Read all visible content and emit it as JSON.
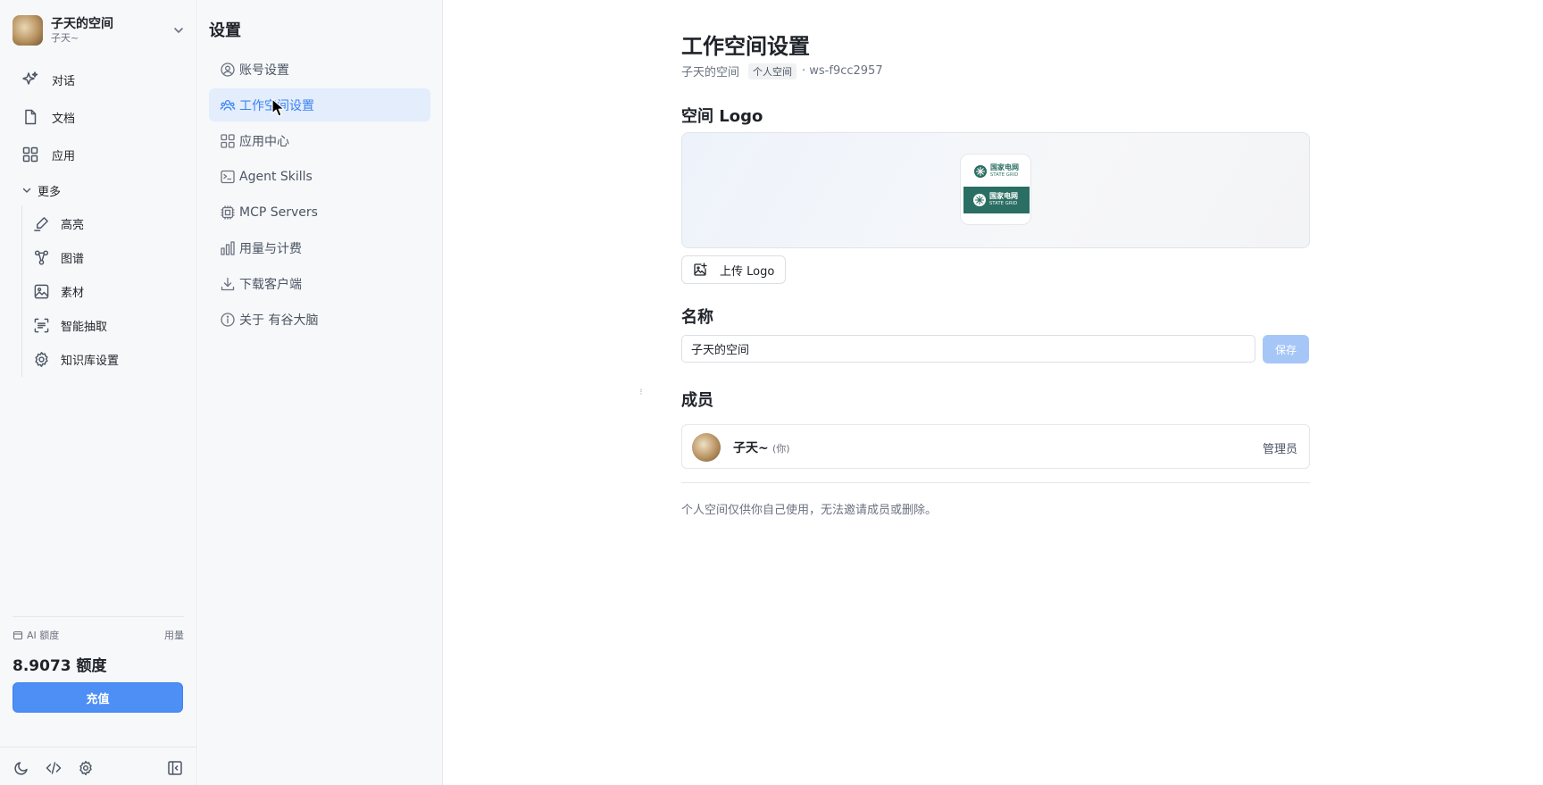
{
  "workspace": {
    "name": "子天的空间",
    "user": "子天~"
  },
  "nav": {
    "items": [
      {
        "label": "对话",
        "icon": "sparkle-icon"
      },
      {
        "label": "文档",
        "icon": "document-icon"
      },
      {
        "label": "应用",
        "icon": "apps-grid-icon"
      }
    ],
    "more_label": "更多",
    "sub_items": [
      {
        "label": "高亮",
        "icon": "highlighter-icon"
      },
      {
        "label": "图谱",
        "icon": "graph-icon"
      },
      {
        "label": "素材",
        "icon": "image-icon"
      },
      {
        "label": "智能抽取",
        "icon": "scan-text-icon"
      },
      {
        "label": "知识库设置",
        "icon": "gear-icon"
      }
    ]
  },
  "quota": {
    "label": "AI 额度",
    "usage_link": "用量",
    "value": "8.9073 额度",
    "recharge_label": "充值"
  },
  "bottom_bar": {
    "icons": [
      "moon-icon",
      "code-icon",
      "gear-icon",
      "collapse-sidebar-icon"
    ]
  },
  "settings": {
    "title": "设置",
    "items": [
      {
        "label": "账号设置",
        "icon": "user-circle-icon"
      },
      {
        "label": "工作空间设置",
        "icon": "users-icon",
        "active": true
      },
      {
        "label": "应用中心",
        "icon": "apps-grid-icon"
      },
      {
        "label": "Agent Skills",
        "icon": "terminal-icon"
      },
      {
        "label": "MCP Servers",
        "icon": "cpu-icon"
      },
      {
        "label": "用量与计费",
        "icon": "bar-chart-icon"
      },
      {
        "label": "下载客户端",
        "icon": "download-icon"
      },
      {
        "label": "关于 有谷大脑",
        "icon": "info-icon"
      }
    ]
  },
  "main": {
    "title": "工作空间设置",
    "subtitle_name": "子天的空间",
    "subtitle_tag": "个人空间",
    "subtitle_id": "· ws-f9cc2957",
    "logo_section": "空间 Logo",
    "logo_cn": "国家电网",
    "logo_en": "STATE GRID",
    "upload_label": "上传 Logo",
    "name_section": "名称",
    "name_value": "子天的空间",
    "save_label": "保存",
    "members_section": "成员",
    "members": [
      {
        "name": "子天~",
        "you": "(你)",
        "role": "管理员"
      }
    ],
    "note": "个人空间仅供你自己使用，无法邀请成员或删除。"
  },
  "colors": {
    "accent": "#4d8ff5",
    "active_bg": "#e3edfc",
    "state_grid_green": "#2b6e63"
  }
}
